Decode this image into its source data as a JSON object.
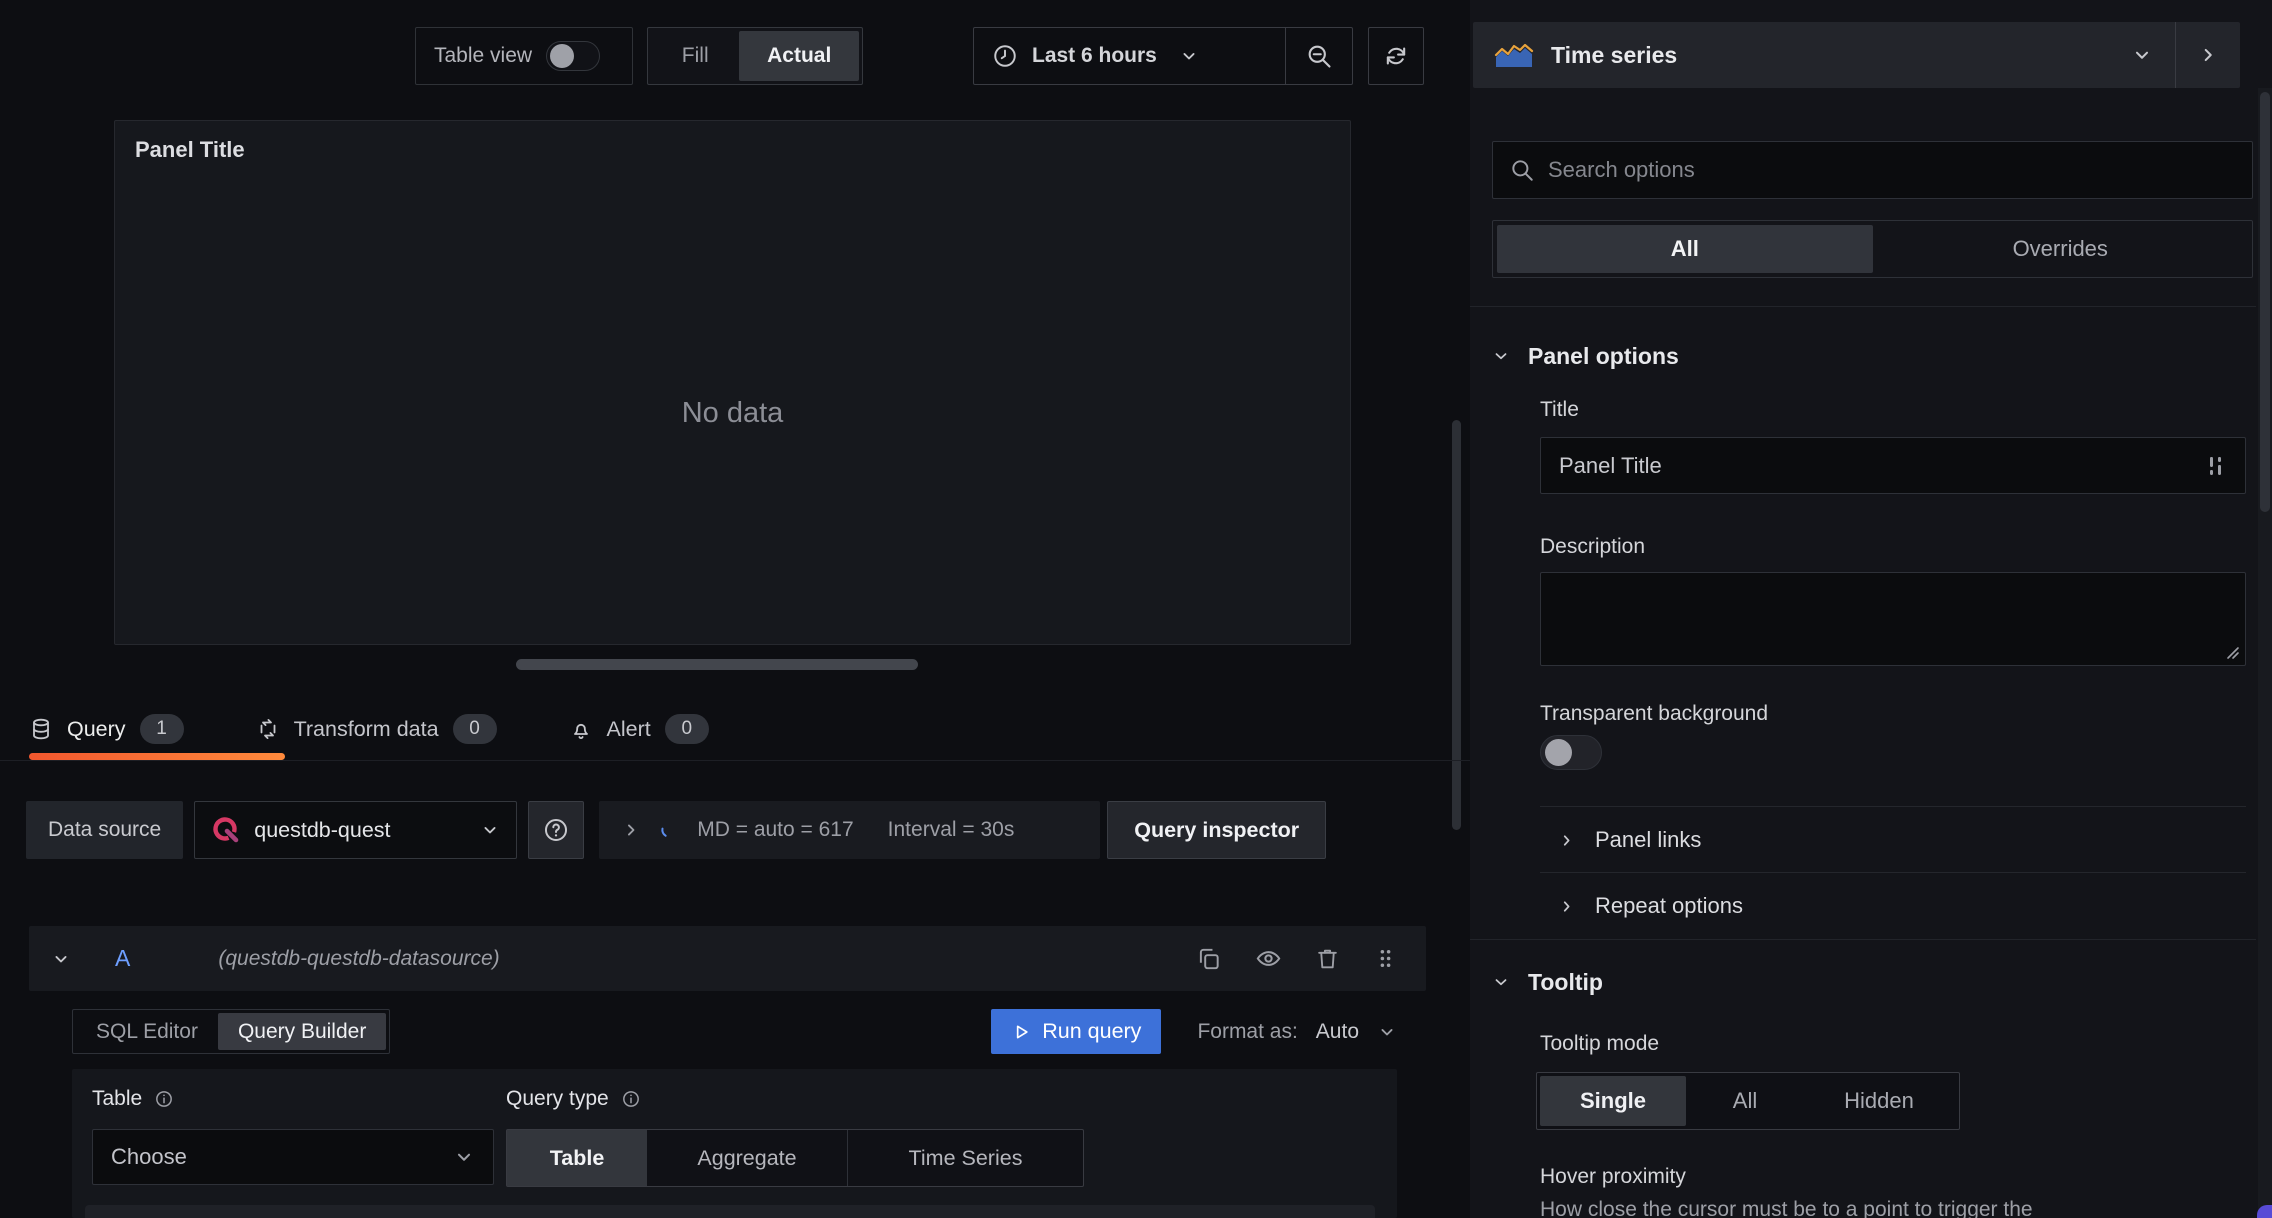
{
  "toolbar": {
    "table_view_label": "Table view",
    "view_mode": {
      "fill": "Fill",
      "actual": "Actual",
      "selected": "Actual"
    },
    "time_range": "Last 6 hours"
  },
  "panel": {
    "title": "Panel Title",
    "no_data_text": "No data"
  },
  "editor_tabs": [
    {
      "label": "Query",
      "count": "1",
      "icon": "database-icon",
      "active": true
    },
    {
      "label": "Transform data",
      "count": "0",
      "icon": "process-icon",
      "active": false
    },
    {
      "label": "Alert",
      "count": "0",
      "icon": "bell-icon",
      "active": false
    }
  ],
  "query_toolbar": {
    "datasource_label": "Data source",
    "datasource_name": "questdb-quest",
    "max_data_points_summary": "MD = auto = 617",
    "interval_summary": "Interval = 30s",
    "query_inspector_label": "Query inspector"
  },
  "query_row": {
    "ref_id": "A",
    "datasource_hint": "(questdb-questdb-datasource)"
  },
  "query_builder": {
    "mode_sql": "SQL Editor",
    "mode_builder": "Query Builder",
    "mode_selected": "Query Builder",
    "run_query_label": "Run query",
    "format_as_label": "Format as:",
    "format_as_value": "Auto",
    "table_label": "Table",
    "table_value": "Choose",
    "query_type_label": "Query type",
    "query_types": [
      "Table",
      "Aggregate",
      "Time Series"
    ],
    "query_type_selected": "Table"
  },
  "options_pane": {
    "visualization": "Time series",
    "search": {
      "placeholder": "Search options",
      "value": ""
    },
    "filter_tabs": {
      "all": "All",
      "overrides": "Overrides",
      "selected": "All"
    },
    "panel_options": {
      "header": "Panel options",
      "title_label": "Title",
      "title_value": "Panel Title",
      "description_label": "Description",
      "description_value": "",
      "transparent_label": "Transparent background",
      "transparent_enabled": false,
      "panel_links_label": "Panel links",
      "repeat_options_label": "Repeat options"
    },
    "tooltip": {
      "header": "Tooltip",
      "mode_label": "Tooltip mode",
      "modes": [
        "Single",
        "All",
        "Hidden"
      ],
      "mode_selected": "Single",
      "hover_proximity_label": "Hover proximity",
      "hover_proximity_help": "How close the cursor must be to a point to trigger the"
    }
  },
  "colors": {
    "run_button_blue": "#3d71d9",
    "ref_id_blue": "#6e9fff",
    "tab_underline_orange": "#ff8a3c",
    "questdb_pink": "#d63864",
    "viz_icon_blue": "#3965b5",
    "viz_icon_orange": "#e8a33d",
    "corner_purple": "#584bd6"
  }
}
